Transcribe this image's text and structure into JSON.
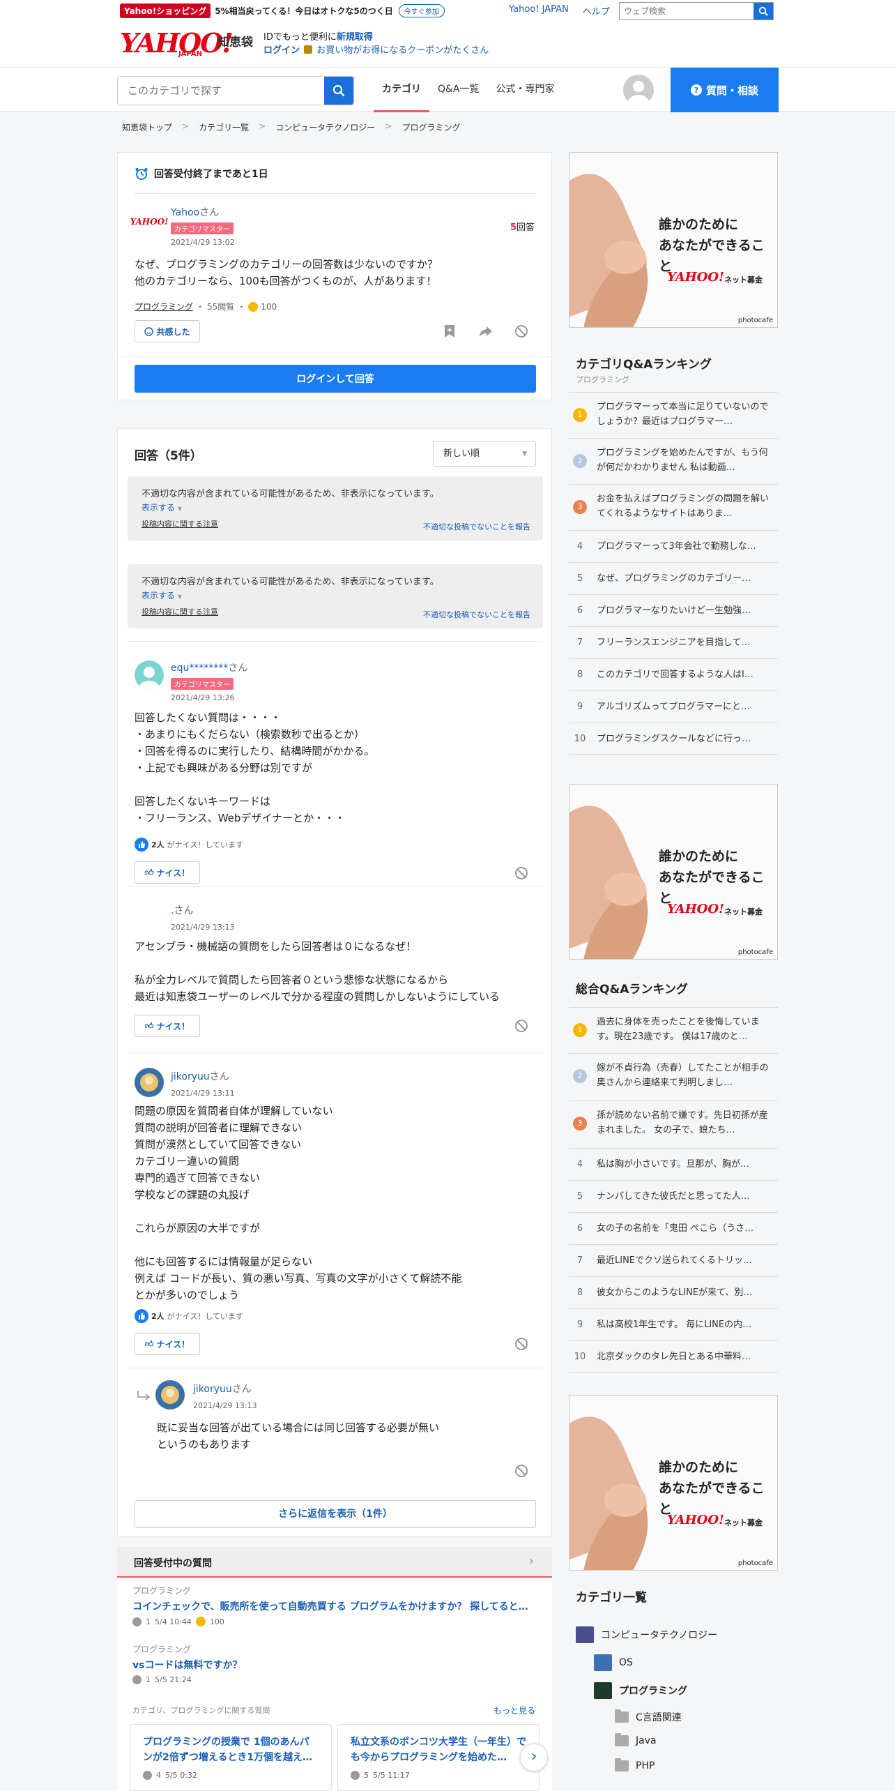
{
  "header": {
    "shopping_label": "Yahoo!ショッピング",
    "promo_text": "5%相当戻ってくる！今日はオトクな5のつく日",
    "promo_pill": "今すぐ参加",
    "yahoo_japan_link": "Yahoo! JAPAN",
    "help_link": "ヘルプ",
    "web_search_placeholder": "ウェブ検索",
    "logo_text": "YAHOO!",
    "logo_sub": "JAPAN",
    "service_name": "知恵袋",
    "id_msg_1": "IDでもっと便利に",
    "id_msg_signup": "新規取得",
    "id_msg_login": "ログイン",
    "id_msg_2": "お買い物がお得になるクーポンがたくさん"
  },
  "nav": {
    "search_placeholder": "このカテゴリで探す",
    "tabs": [
      "カテゴリ",
      "Q&A一覧",
      "公式・専門家"
    ],
    "ask_button": "質問・相談"
  },
  "breadcrumb": [
    "知恵袋トップ",
    "カテゴリ一覧",
    "コンピュータテクノロジー",
    "プログラミング"
  ],
  "question": {
    "deadline": "回答受付終了まであと1日",
    "user": "Yahoo",
    "san": "さん",
    "badge": "カテゴリマスター",
    "date": "2021/4/29 13:02",
    "answer_count": "5",
    "answer_label": "回答",
    "body": "なぜ、プログラミングのカテゴリーの回答数は少ないのですか？\n他のカテゴリーなら、100も回答がつくものが、人があります！",
    "category": "プログラミング",
    "views": "55閲覧",
    "coins": "100",
    "empathy_button": "共感した",
    "login_answer_button": "ログインして回答"
  },
  "answers_section": {
    "title": "回答（5件）",
    "sort": "新しい順",
    "hidden_msg": "不適切な内容が含まれている可能性があるため、非表示になっています。",
    "show_link": "表示する",
    "notice_link": "投稿内容に関する注意",
    "report_link": "不適切な投稿でないことを報告"
  },
  "answers": [
    {
      "user": "equ********",
      "san": "さん",
      "badge": "カテゴリマスター",
      "date": "2021/4/29 13:26",
      "body": "回答したくない質問は・・・・\n・あまりにもくだらない（検索数秒で出るとか）\n・回答を得るのに実行したり、結構時間がかかる。\n・上記でも興味がある分野は別ですが\n\n回答したくないキーワードは\n・フリーランス、Webデザイナーとか・・・",
      "nice_count": "2人",
      "nice_text": "がナイス！しています",
      "nice_button": "ナイス！"
    },
    {
      "user": ".",
      "san": "さん",
      "date": "2021/4/29 13:13",
      "body": "アセンブラ・機械語の質問をしたら回答者は０になるなぜ！\n\n私が全力レベルで質問したら回答者０という悲惨な状態になるから\n最近は知恵袋ユーザーのレベルで分かる程度の質問しかしないようにしている",
      "nice_button": "ナイス！"
    },
    {
      "user": "jikoryuu",
      "san": "さん",
      "date": "2021/4/29 13:11",
      "body": "問題の原因を質問者自体が理解していない\n質問の説明が回答者に理解できない\n質問が漠然としていて回答できない\nカテゴリー違いの質問\n専門的過ぎて回答できない\n学校などの課題の丸投げ\n\nこれらが原因の大半ですが\n\n他にも回答するには情報量が足らない\n例えば コードが長い、質の悪い写真、写真の文字が小さくて解読不能\nとかが多いのでしょう",
      "nice_count": "2人",
      "nice_text": "がナイス！しています",
      "nice_button": "ナイス！"
    }
  ],
  "reply": {
    "user": "jikoryuu",
    "san": "さん",
    "date": "2021/4/29 13:13",
    "body": "既に妥当な回答が出ている場合には同じ回答する必要が無い\nというのもあります",
    "more_button": "さらに返信を表示（1件）"
  },
  "open_questions": {
    "title": "回答受付中の質問",
    "items": [
      {
        "category": "プログラミング",
        "title": "コインチェックで、販売所を使って自動売買する プログラムをかけますか？ 探してると…",
        "answers": "1",
        "date": "5/4 10:44",
        "coins": "100"
      },
      {
        "category": "プログラミング",
        "title": "vsコードは無料ですか？",
        "answers": "1",
        "date": "5/5 21:24"
      }
    ],
    "related_label": "カテゴリ、プログラミングに関する質問",
    "more_link": "もっと見る",
    "related": [
      {
        "title": "プログラミングの授業で 1個のあんパンが2倍ずつ増えるとき1万個を越え…",
        "answers": "4",
        "date": "5/5 0:32"
      },
      {
        "title": "私立文系のポンコツ大学生（一年生）でも今からプログラミングを始めた…",
        "answers": "5",
        "date": "5/5 11:17"
      }
    ]
  },
  "ads": {
    "line1": "誰かのために",
    "line2": "あなたができること",
    "brand": "YAHOO!",
    "brand_sub": "ネット募金",
    "credit": "photocafe"
  },
  "category_ranking": {
    "title": "カテゴリQ&Aランキング",
    "subtitle": "プログラミング",
    "items": [
      "プログラマーって本当に足りていないのでしょうか？最近はプログラマー…",
      "プログラミングを始めたんですが、もう何が何だかわかりません 私は動画…",
      "お金を払えばプログラミングの問題を解いてくれるようなサイトはありま…",
      "プログラマーって3年会社で勤務しな…",
      "なぜ、プログラミングのカテゴリー…",
      "プログラマーなりたいけど一生勉強…",
      "フリーランスエンジニアを目指して…",
      "このカテゴリで回答するような人はI…",
      "アルゴリズムってプログラマーにと…",
      "プログラミングスクールなどに行っ…"
    ]
  },
  "overall_ranking": {
    "title": "総合Q&Aランキング",
    "items": [
      "過去に身体を売ったことを後悔しています。現在23歳です。 僕は17歳のと…",
      "嫁が不貞行為（売春）してたことが相手の奥さんから連絡来て判明しまし…",
      "孫が読めない名前で嫌です。先日初孫が産まれました。 女の子で、娘たち…",
      "私は胸が小さいです。旦那が、胸が…",
      "ナンパしてきた彼氏だと思ってた人…",
      "女の子の名前を「鬼田 ぺこら（うさ…",
      "最近LINEでクソ送られてくるトリッ…",
      "彼女からこのようなLINEが来て、別…",
      "私は高校1年生です。 毎にLINEの内…",
      "北京ダックのタレ先日とある中華料…"
    ]
  },
  "category_list": {
    "title": "カテゴリ一覧",
    "items": [
      "コンピュータテクノロジー",
      "OS",
      "プログラミング",
      "C言語関連",
      "Java",
      "PHP"
    ]
  },
  "colors": {
    "accent": "#1a7cf1",
    "link": "#1a5db4",
    "badge": "#f06b80",
    "gold": "#f5b800",
    "silver": "#b5c8de",
    "bronze": "#ea8150"
  }
}
